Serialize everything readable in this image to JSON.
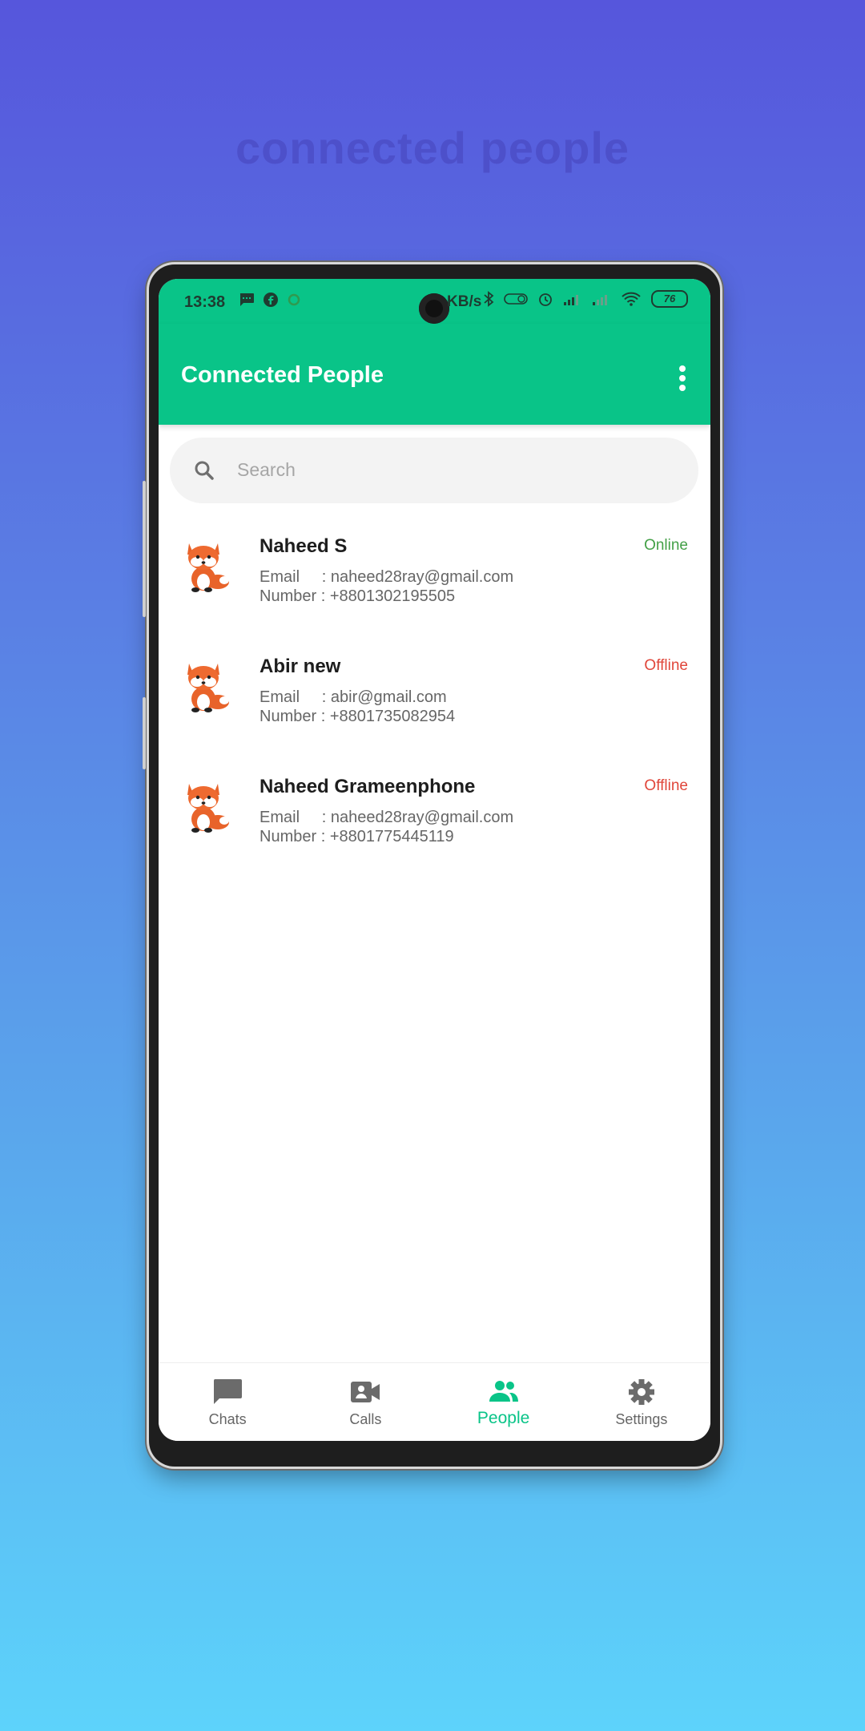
{
  "background_caption": "connected people",
  "status_bar": {
    "time": "13:38",
    "speed": "KB/s",
    "battery": "76"
  },
  "app_bar": {
    "title": "Connected People"
  },
  "search": {
    "placeholder": "Search"
  },
  "contacts": [
    {
      "name": "Naheed S",
      "status": "Online",
      "email_label": "Email     : ",
      "email": "naheed28ray@gmail.com",
      "number_label": "Number : ",
      "number": "+8801302195505"
    },
    {
      "name": "Abir new",
      "status": "Offline",
      "email_label": "Email     : ",
      "email": "abir@gmail.com",
      "number_label": "Number : ",
      "number": "+8801735082954"
    },
    {
      "name": "Naheed Grameenphone",
      "status": "Offline",
      "email_label": "Email     : ",
      "email": "naheed28ray@gmail.com",
      "number_label": "Number : ",
      "number": "+8801775445119"
    }
  ],
  "bottom_nav": {
    "items": [
      {
        "label": "Chats",
        "icon": "chat-icon"
      },
      {
        "label": "Calls",
        "icon": "video-call-icon"
      },
      {
        "label": "People",
        "icon": "people-icon"
      },
      {
        "label": "Settings",
        "icon": "gear-icon"
      }
    ],
    "active": "People"
  },
  "colors": {
    "accent": "#09c488",
    "online": "#43a047",
    "offline": "#e0463a"
  }
}
